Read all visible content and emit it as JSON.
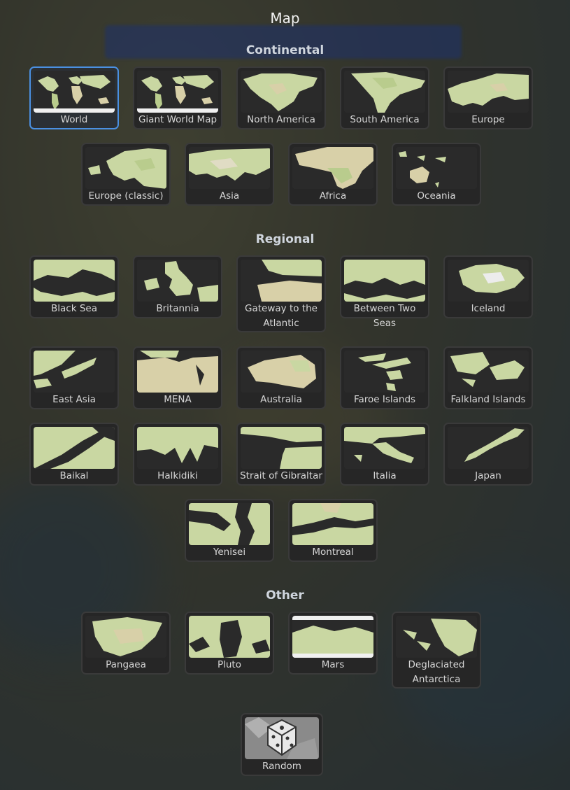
{
  "dialog": {
    "title": "Map"
  },
  "sections": {
    "continental": "Continental",
    "regional": "Regional",
    "other": "Other"
  },
  "maps": {
    "world": "World",
    "giant_world": "Giant World Map",
    "north_america": "North America",
    "south_america": "South America",
    "europe": "Europe",
    "europe_classic": "Europe (classic)",
    "asia": "Asia",
    "africa": "Africa",
    "oceania": "Oceania",
    "black_sea": "Black Sea",
    "britannia": "Britannia",
    "gateway": "Gateway to the Atlantic",
    "two_seas": "Between Two Seas",
    "iceland": "Iceland",
    "east_asia": "East Asia",
    "mena": "MENA",
    "australia": "Australia",
    "faroe": "Faroe Islands",
    "falkland": "Falkland Islands",
    "baikal": "Baikal",
    "halkidiki": "Halkidiki",
    "gibraltar": "Strait of Gibraltar",
    "italia": "Italia",
    "japan": "Japan",
    "yenisei": "Yenisei",
    "montreal": "Montreal",
    "pangaea": "Pangaea",
    "pluto": "Pluto",
    "mars": "Mars",
    "antarctica": "Deglaciated Antarctica",
    "random": "Random"
  },
  "selected_map": "World",
  "colors": {
    "land": "#c9d7a2",
    "land_dark": "#a8c07a",
    "water": "#2a2a2a",
    "accent": "#4a90e2"
  }
}
